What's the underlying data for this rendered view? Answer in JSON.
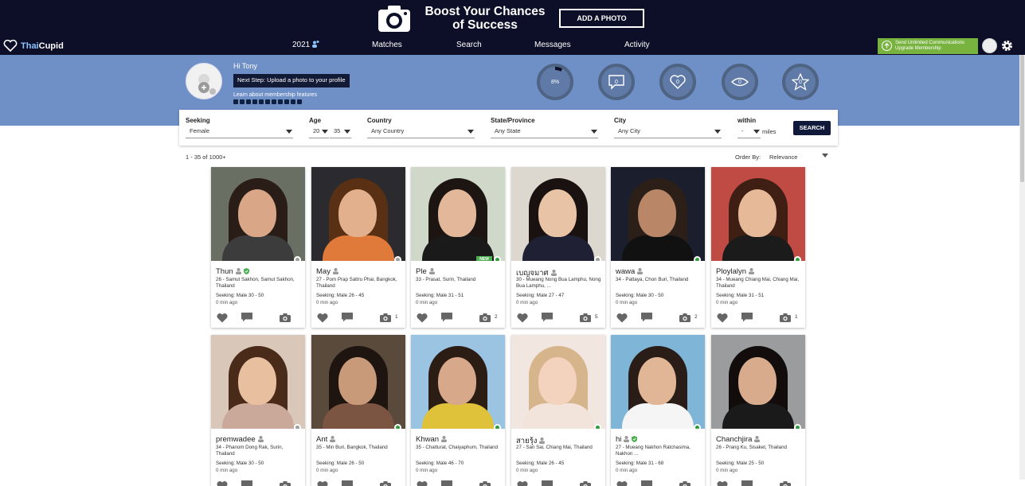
{
  "promo": {
    "title_line1": "Boost Your Chances",
    "title_line2": "of Success",
    "button": "ADD A PHOTO"
  },
  "nav": {
    "logo_thai": "Thai",
    "logo_cupid": "Cupid",
    "items": [
      "2021",
      "Matches",
      "Search",
      "Messages",
      "Activity"
    ],
    "upgrade_line1": "Send Unlimited Communications",
    "upgrade_line2": "Upgrade Membership"
  },
  "profile": {
    "greeting": "Hi Tony",
    "next_step": "Next Step: Upload a photo to your profile",
    "learn": "Learn about membership features",
    "stats": [
      {
        "name": "profile-completion",
        "value": "8%",
        "icon": "progress-ring-icon",
        "fraction": 0.08
      },
      {
        "name": "messages",
        "value": "0",
        "icon": "chat-bubble-icon"
      },
      {
        "name": "likes",
        "value": "0",
        "icon": "heart-icon"
      },
      {
        "name": "views",
        "value": "0",
        "icon": "eye-icon"
      },
      {
        "name": "favorites",
        "value": "0",
        "icon": "star-icon"
      }
    ]
  },
  "search": {
    "seeking_label": "Seeking",
    "seeking_value": "Female",
    "age_label": "Age",
    "age_min": "20",
    "age_max": "35",
    "country_label": "Country",
    "country_value": "Any Country",
    "state_label": "State/Province",
    "state_value": "Any State",
    "city_label": "City",
    "city_value": "Any City",
    "within_label": "within",
    "within_value": "-",
    "miles": "miles",
    "button": "SEARCH"
  },
  "results": {
    "count": "1 - 35 of 1000+",
    "order_label": "Order By:",
    "order_value": "Relevance"
  },
  "cards": [
    {
      "name": "Thun",
      "location": "26 - Samut Sakhon, Samut Sakhon, Thailand",
      "seeking": "Seeking: Male 30 - 50",
      "time": "0 min ago",
      "photos": "",
      "online": false,
      "verified": true,
      "new": false
    },
    {
      "name": "May",
      "location": "27 - Pom Prap Sattru Phai, Bangkok, Thailand",
      "seeking": "Seeking: Male 26 - 45",
      "time": "0 min ago",
      "photos": "1",
      "online": false,
      "verified": false,
      "new": false
    },
    {
      "name": "Ple",
      "location": "33 - Prasat, Surin, Thailand",
      "seeking": "Seeking: Male 31 - 51",
      "time": "0 min ago",
      "photos": "2",
      "online": true,
      "verified": false,
      "new": true
    },
    {
      "name": "เบญจมาศ",
      "location": "30 - Mueang Nong Bua Lamphu, Nong Bua Lamphu, ...",
      "seeking": "Seeking: Male 27 - 47",
      "time": "0 min ago",
      "photos": "5",
      "online": false,
      "verified": false,
      "new": false
    },
    {
      "name": "wawa",
      "location": "34 - Pattaya, Chon Buri, Thailand",
      "seeking": "Seeking: Male 30 - 50",
      "time": "0 min ago",
      "photos": "2",
      "online": true,
      "verified": false,
      "new": false
    },
    {
      "name": "Ploylalyn",
      "location": "34 - Mueang Chiang Mai, Chiang Mai, Thailand",
      "seeking": "Seeking: Male 31 - 51",
      "time": "0 min ago",
      "photos": "1",
      "online": true,
      "verified": false,
      "new": false
    },
    {
      "name": "premwadee",
      "location": "34 - Phanom Dong Rak, Surin, Thailand",
      "seeking": "Seeking: Male 30 - 50",
      "time": "0 min ago",
      "photos": "",
      "online": false,
      "verified": false,
      "new": false
    },
    {
      "name": "Ant",
      "location": "35 - Min Buri, Bangkok, Thailand",
      "seeking": "Seeking: Male 26 - 50",
      "time": "0 min ago",
      "photos": "",
      "online": true,
      "verified": false,
      "new": false
    },
    {
      "name": "Khwan",
      "location": "35 - Chatturat, Chaiyaphum, Thailand",
      "seeking": "Seeking: Male 46 - 70",
      "time": "0 min ago",
      "photos": "",
      "online": true,
      "verified": false,
      "new": false
    },
    {
      "name": "สายรุ้ง",
      "location": "27 - San Sai, Chiang Mai, Thailand",
      "seeking": "Seeking: Male 26 - 45",
      "time": "0 min ago",
      "photos": "",
      "online": true,
      "verified": false,
      "new": false
    },
    {
      "name": "hi",
      "location": "27 - Mueang Nakhon Ratchasima, Nakhon ...",
      "seeking": "Seeking: Male 31 - 68",
      "time": "0 min ago",
      "photos": "",
      "online": true,
      "verified": true,
      "new": false
    },
    {
      "name": "Chanchjira",
      "location": "26 - Prang Ku, Sisaket, Thailand",
      "seeking": "Seeking: Male 25 - 50",
      "time": "0 min ago",
      "photos": "",
      "online": true,
      "verified": false,
      "new": false
    }
  ],
  "colors": {
    "online": "#2e9e3a",
    "offline": "#9e9e9e",
    "navy": "#0c0f27",
    "band": "#6f8fc7",
    "upgrade": "#78b340"
  }
}
